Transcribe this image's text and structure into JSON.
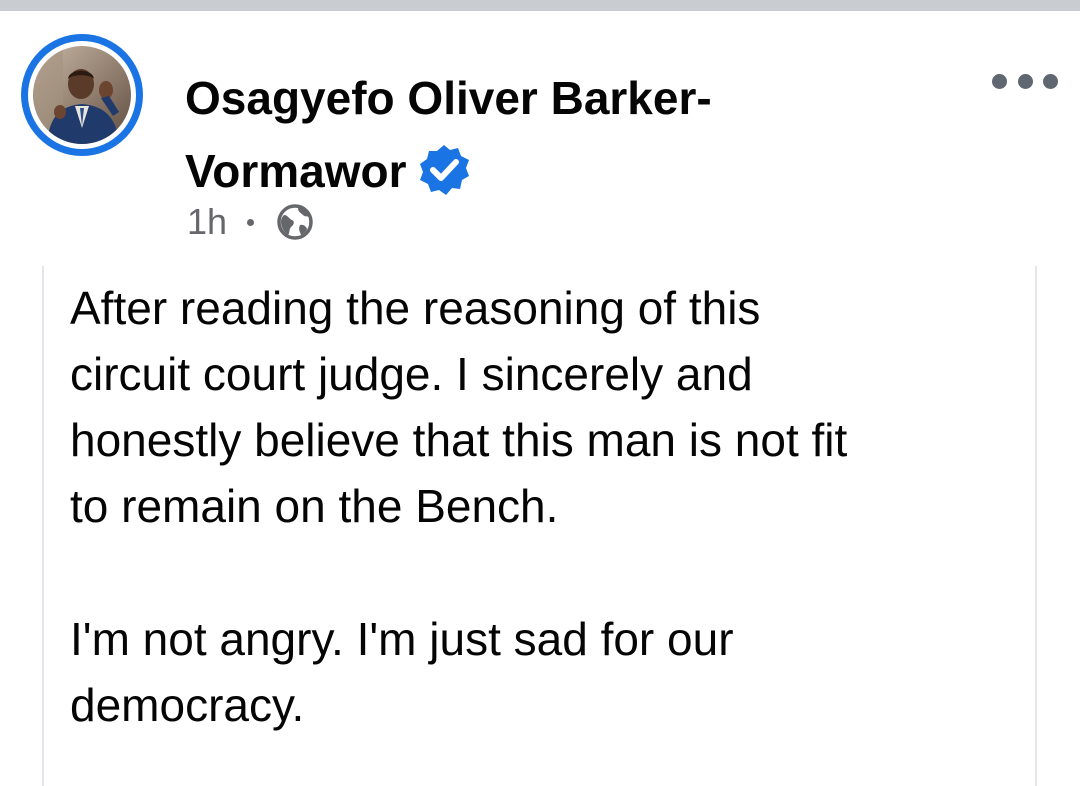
{
  "post": {
    "author": {
      "name_line1": "Osagyefo Oliver Barker-",
      "name_line2": "Vormawor",
      "verified": true,
      "avatar_icon": "profile-photo-man-in-suit"
    },
    "meta": {
      "time": "1h",
      "audience_icon": "globe-icon"
    },
    "menu_icon": "more-horizontal-icon",
    "paragraphs": [
      "After reading the reasoning of this\ncircuit court judge. I sincerely and\nhonestly believe that this man is not fit\nto remain on the Bench.",
      "I'm not angry. I'm just sad for our\ndemocracy."
    ]
  },
  "colors": {
    "accent": "#1b74e4",
    "text": "#050505",
    "secondary_text": "#65676b",
    "top_strip": "#c9ccd1"
  }
}
